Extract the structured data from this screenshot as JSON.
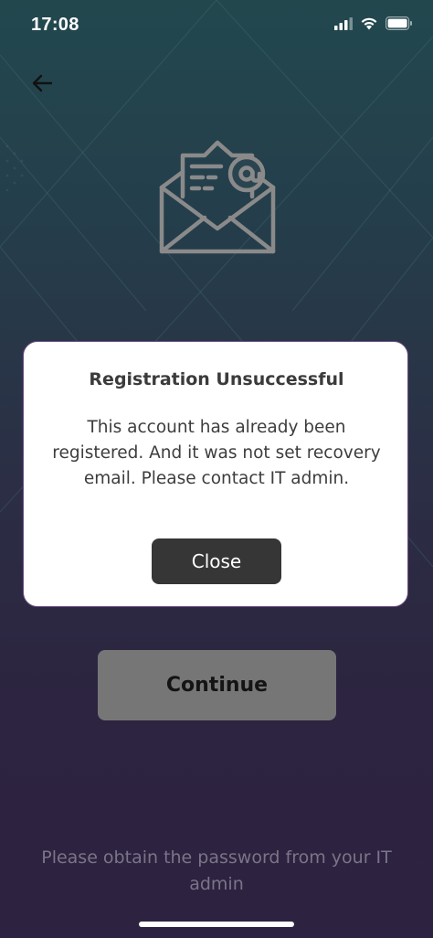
{
  "status_bar": {
    "time": "17:08",
    "icons": [
      "cellular-signal-icon",
      "wifi-icon",
      "battery-icon"
    ]
  },
  "header": {
    "back_icon": "arrow-left-icon"
  },
  "illustration": {
    "icon": "envelope-at-icon"
  },
  "main": {
    "continue_label": "Continue",
    "footer_note": "Please obtain the password from your IT admin"
  },
  "dialog": {
    "title": "Registration Unsuccessful",
    "message": "This account has already been registered. And it was not set recovery email. Please contact IT admin.",
    "close_label": "Close"
  },
  "colors": {
    "background_top": "#22484e",
    "background_bottom": "#2e2241",
    "continue_button": "#767676",
    "close_button": "#363636",
    "dialog_border": "#6f4d86",
    "footer_text": "#7a7588"
  }
}
